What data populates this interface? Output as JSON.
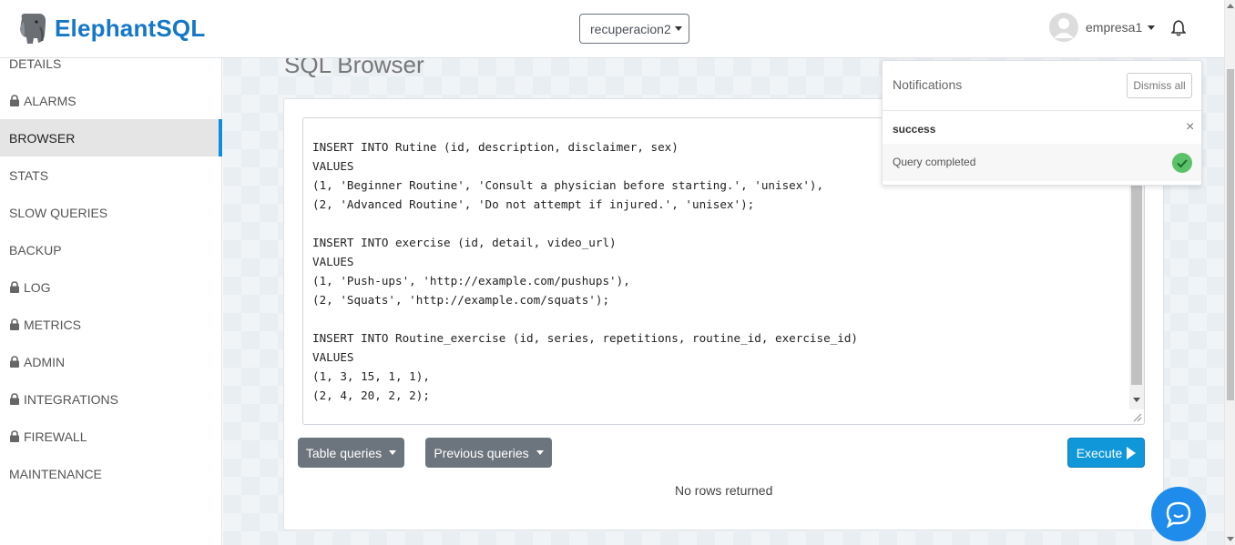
{
  "brand": {
    "name": "ElephantSQL",
    "color": "#1577c7"
  },
  "header": {
    "instance": "recuperacion2",
    "user": "empresa1"
  },
  "sidebar": {
    "items": [
      {
        "label": "DETAILS",
        "locked": false,
        "active": false
      },
      {
        "label": "ALARMS",
        "locked": true,
        "active": false
      },
      {
        "label": "BROWSER",
        "locked": false,
        "active": true
      },
      {
        "label": "STATS",
        "locked": false,
        "active": false
      },
      {
        "label": "SLOW QUERIES",
        "locked": false,
        "active": false
      },
      {
        "label": "BACKUP",
        "locked": false,
        "active": false
      },
      {
        "label": "LOG",
        "locked": true,
        "active": false
      },
      {
        "label": "METRICS",
        "locked": true,
        "active": false
      },
      {
        "label": "ADMIN",
        "locked": true,
        "active": false
      },
      {
        "label": "INTEGRATIONS",
        "locked": true,
        "active": false
      },
      {
        "label": "FIREWALL",
        "locked": true,
        "active": false
      },
      {
        "label": "MAINTENANCE",
        "locked": false,
        "active": false
      }
    ]
  },
  "main": {
    "title": "SQL Browser",
    "editor_lines": [
      "",
      "INSERT INTO Rutine (id, description, disclaimer, sex)",
      "VALUES",
      "(1, 'Beginner Routine', 'Consult a physician before starting.', 'unisex'),",
      "(2, 'Advanced Routine', 'Do not attempt if injured.', 'unisex');",
      "",
      "INSERT INTO exercise (id, detail, video_url)",
      "VALUES",
      "(1, 'Push-ups', 'http://example.com/pushups'),",
      "(2, 'Squats', 'http://example.com/squats');",
      "",
      "INSERT INTO Routine_exercise (id, series, repetitions, routine_id, exercise_id)",
      "VALUES",
      "(1, 3, 15, 1, 1),",
      "(2, 4, 20, 2, 2);"
    ],
    "table_queries_label": "Table queries",
    "previous_queries_label": "Previous queries",
    "execute_label": "Execute",
    "result_text": "No rows returned"
  },
  "notifications": {
    "title": "Notifications",
    "dismiss_label": "Dismiss all",
    "items": [
      {
        "type": "success",
        "message": "Query completed",
        "close": "×"
      }
    ]
  },
  "colors": {
    "accent": "#0f97da",
    "success": "#5cc26a",
    "chat": "#1f8ceb"
  },
  "icons": [
    "elephant-logo-icon",
    "user-avatar-icon",
    "bell-icon",
    "lock-icon",
    "play-icon",
    "check-icon",
    "chat-icon"
  ]
}
